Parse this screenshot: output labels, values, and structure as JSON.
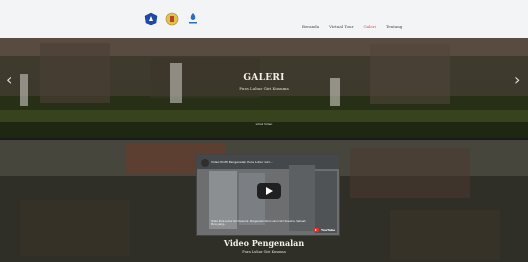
{
  "nav": {
    "logos": [
      "crest-logo",
      "temple-logo",
      "tree-logo"
    ],
    "links": [
      {
        "label": "Beranda",
        "active": false
      },
      {
        "label": "Virtual Tour",
        "active": false
      },
      {
        "label": "Galeri",
        "active": true
      },
      {
        "label": "Tentang",
        "active": false
      }
    ]
  },
  "hero": {
    "title": "GALERI",
    "subtitle": "Pura Luhur Giri Kusuma",
    "link": "Lihat Video"
  },
  "video": {
    "title": "Video Profil Pengenalan Pura Luhur Giri...",
    "caption": "Video Pura Luhur Giri Kusuma. Pengenalan Pura Luhur Giri Kusuma, Sebuah Pura yang...",
    "platform": "YouTube",
    "label": "Video Pengenalan",
    "sublabel": "Pura Luhur Giri Kusuma"
  },
  "colors": {
    "navbar": "#f3f4f6",
    "active_link": "#d9534f",
    "text_light": "#f4f1ea"
  }
}
